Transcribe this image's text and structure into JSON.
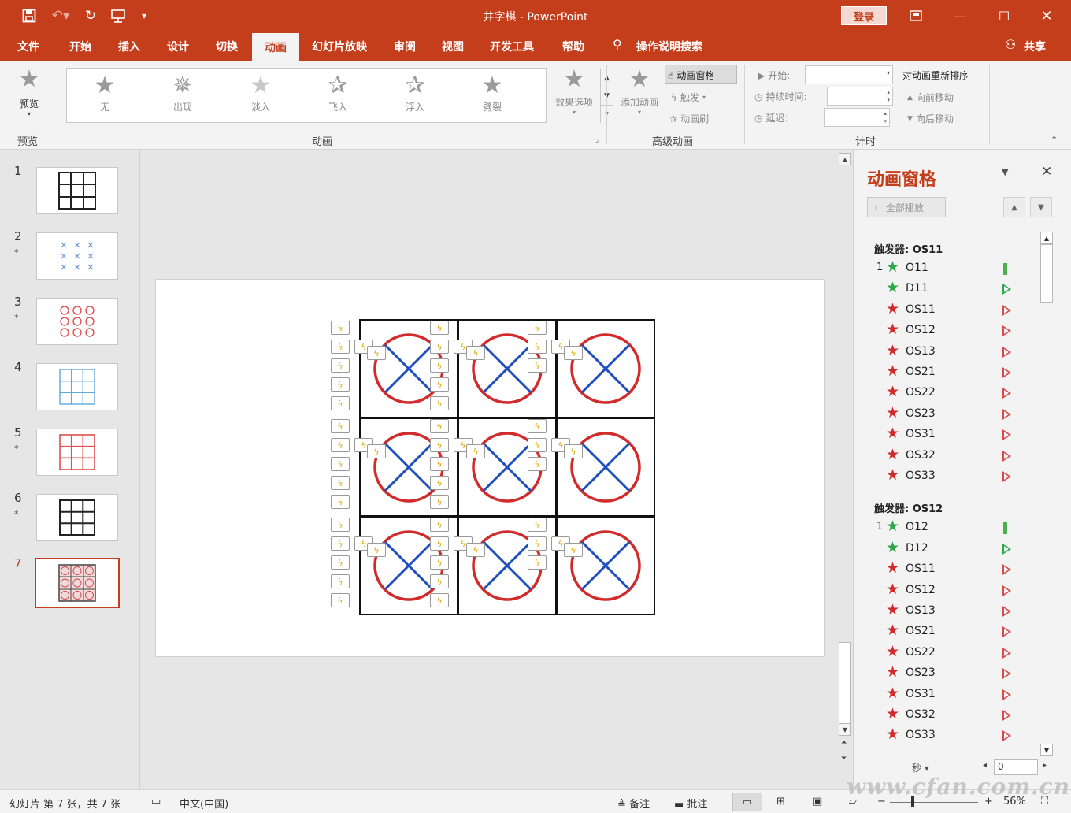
{
  "window": {
    "title": "井字棋 - PowerPoint",
    "login": "登录"
  },
  "tabs": [
    "文件",
    "开始",
    "插入",
    "设计",
    "切换",
    "动画",
    "幻灯片放映",
    "审阅",
    "视图",
    "开发工具",
    "帮助"
  ],
  "active_tab": "动画",
  "tell_me": "操作说明搜索",
  "share": "共享",
  "ribbon": {
    "preview": {
      "label": "预览",
      "group": "预览"
    },
    "animations": {
      "group": "动画",
      "gallery": [
        "无",
        "出现",
        "淡入",
        "飞入",
        "浮入",
        "劈裂"
      ],
      "effect_options": "效果选项"
    },
    "advanced": {
      "group": "高级动画",
      "add_animation": "添加动画",
      "animation_pane": "动画窗格",
      "trigger": "触发",
      "painter": "动画刷"
    },
    "timing": {
      "group": "计时",
      "start": "开始:",
      "duration": "持续时间:",
      "delay": "延迟:",
      "reorder": "对动画重新排序",
      "move_earlier": "向前移动",
      "move_later": "向后移动"
    }
  },
  "slides": [
    {
      "num": "1",
      "star": ""
    },
    {
      "num": "2",
      "star": "*"
    },
    {
      "num": "3",
      "star": "*"
    },
    {
      "num": "4",
      "star": ""
    },
    {
      "num": "5",
      "star": "*"
    },
    {
      "num": "6",
      "star": "*"
    },
    {
      "num": "7",
      "star": ""
    }
  ],
  "pane": {
    "title": "动画窗格",
    "play_all": "全部播放",
    "groups": [
      {
        "trigger": "触发器: OS11",
        "items": [
          {
            "n": "1",
            "label": "O11",
            "color": "green",
            "bar": "green-bar"
          },
          {
            "n": "",
            "label": "D11",
            "color": "green",
            "bar": "green-tri"
          },
          {
            "n": "",
            "label": "OS11",
            "color": "red",
            "bar": "red-tri"
          },
          {
            "n": "",
            "label": "OS12",
            "color": "red",
            "bar": "red-tri"
          },
          {
            "n": "",
            "label": "OS13",
            "color": "red",
            "bar": "red-tri"
          },
          {
            "n": "",
            "label": "OS21",
            "color": "red",
            "bar": "red-tri"
          },
          {
            "n": "",
            "label": "OS22",
            "color": "red",
            "bar": "red-tri"
          },
          {
            "n": "",
            "label": "OS23",
            "color": "red",
            "bar": "red-tri"
          },
          {
            "n": "",
            "label": "OS31",
            "color": "red",
            "bar": "red-tri"
          },
          {
            "n": "",
            "label": "OS32",
            "color": "red",
            "bar": "red-tri"
          },
          {
            "n": "",
            "label": "OS33",
            "color": "red",
            "bar": "red-tri"
          }
        ]
      },
      {
        "trigger": "触发器: OS12",
        "items": [
          {
            "n": "1",
            "label": "O12",
            "color": "green",
            "bar": "green-bar"
          },
          {
            "n": "",
            "label": "D12",
            "color": "green",
            "bar": "green-tri"
          },
          {
            "n": "",
            "label": "OS11",
            "color": "red",
            "bar": "red-tri"
          },
          {
            "n": "",
            "label": "OS12",
            "color": "red",
            "bar": "red-tri"
          },
          {
            "n": "",
            "label": "OS13",
            "color": "red",
            "bar": "red-tri"
          },
          {
            "n": "",
            "label": "OS21",
            "color": "red",
            "bar": "red-tri"
          },
          {
            "n": "",
            "label": "OS22",
            "color": "red",
            "bar": "red-tri"
          },
          {
            "n": "",
            "label": "OS23",
            "color": "red",
            "bar": "red-tri"
          },
          {
            "n": "",
            "label": "OS31",
            "color": "red",
            "bar": "red-tri"
          },
          {
            "n": "",
            "label": "OS32",
            "color": "red",
            "bar": "red-tri"
          },
          {
            "n": "",
            "label": "OS33",
            "color": "red",
            "bar": "red-tri"
          }
        ]
      }
    ],
    "timeline_value": "0",
    "seconds_label": "秒"
  },
  "status": {
    "slide_info": "幻灯片 第 7 张，共 7 张",
    "language": "中文(中国)",
    "notes": "备注",
    "comments": "批注",
    "zoom": "56%"
  },
  "watermark": "www.cfan.com.cn",
  "colors": {
    "accent": "#c43e1c",
    "red": "#d22b2b",
    "green": "#2ba84a",
    "blue": "#1f4fbf"
  }
}
